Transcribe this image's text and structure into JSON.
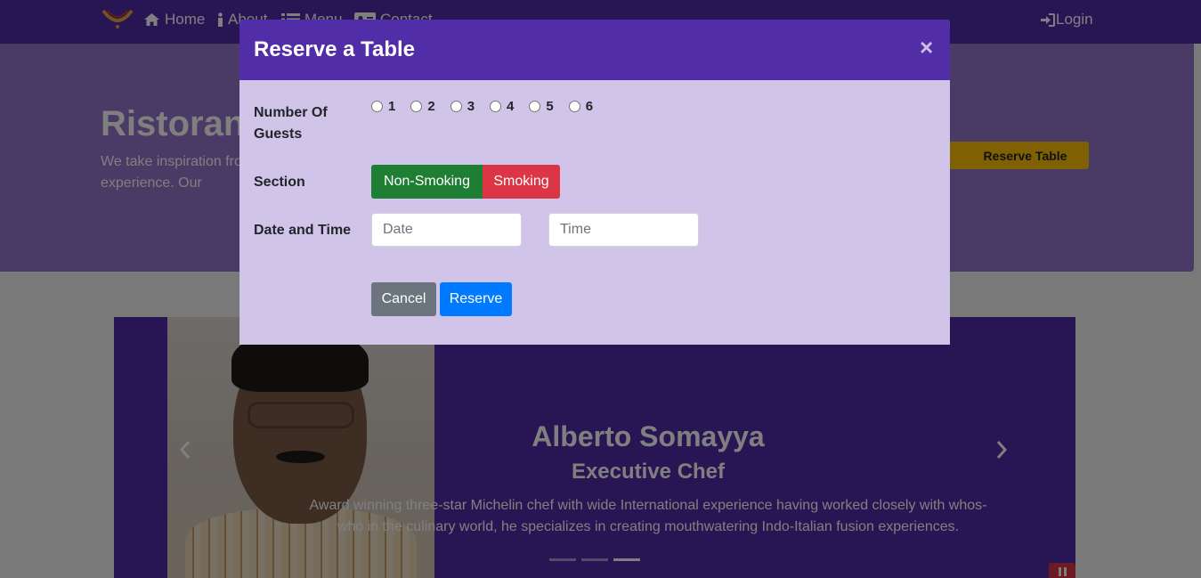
{
  "navbar": {
    "home_label": "Home",
    "about_label": "About",
    "menu_label": "Menu",
    "contact_label": "Contact",
    "login_label": "Login",
    "logo_icon": "restaurant-logo"
  },
  "jumbotron": {
    "title": "Ristorante",
    "text": "We take inspiration from the World's best cuisines, and create a unique fusion experience. Our",
    "reserve_button": "Reserve Table"
  },
  "carousel": {
    "chef_name": "Alberto Somayya",
    "chef_title": "Executive Chef",
    "description": "Award winning three-star Michelin chef with wide International experience having worked closely with whos-who in the culinary world, he specializes in creating mouthwatering Indo-Italian fusion experiences.",
    "prev_icon": "chevron-left-icon",
    "next_icon": "chevron-right-icon",
    "indicators": 3,
    "active_indicator": 3
  },
  "modal": {
    "title": "Reserve a Table",
    "close_glyph": "×",
    "guests_label": "Number Of Guests",
    "guest_options": [
      "1",
      "2",
      "3",
      "4",
      "5",
      "6"
    ],
    "section_label": "Section",
    "section_options": [
      "Non-Smoking",
      "Smoking"
    ],
    "date_time_label": "Date and Time",
    "date_placeholder": "Date",
    "time_placeholder": "Time",
    "cancel_label": "Cancel",
    "reserve_label": "Reserve"
  },
  "colors": {
    "primary": "#512da8",
    "modal_body": "#d1c4e9",
    "success": "#1e7e34",
    "danger": "#dc3545",
    "secondary": "#6c757d",
    "action": "#007bff",
    "warning": "#ffc107"
  }
}
